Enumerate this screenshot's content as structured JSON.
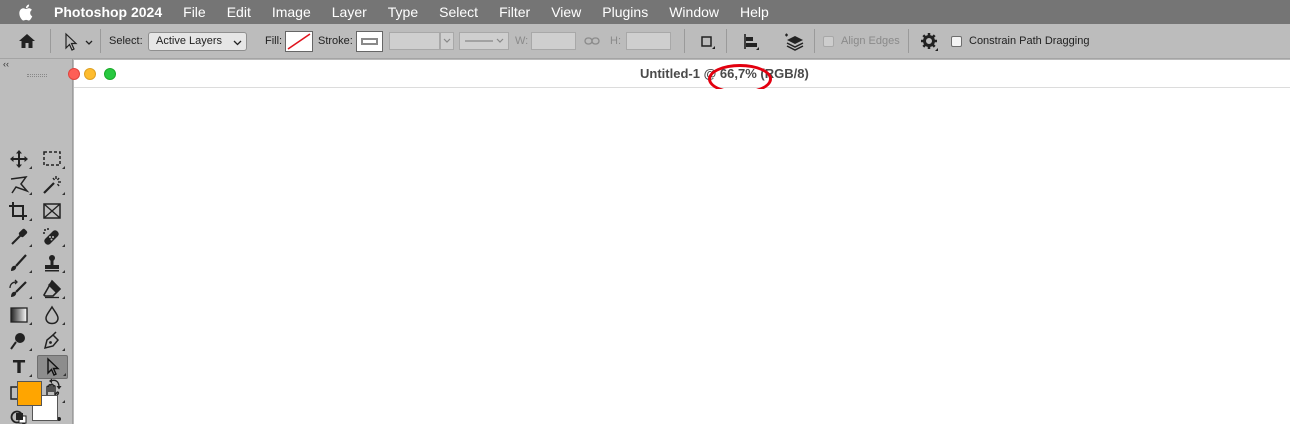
{
  "menubar": {
    "app_name": "Photoshop 2024",
    "items": [
      "File",
      "Edit",
      "Image",
      "Layer",
      "Type",
      "Select",
      "Filter",
      "View",
      "Plugins",
      "Window",
      "Help"
    ]
  },
  "options_bar": {
    "select_label": "Select:",
    "select_value": "Active Layers",
    "fill_label": "Fill:",
    "stroke_label": "Stroke:",
    "w_label": "W:",
    "h_label": "H:",
    "align_edges_label": "Align Edges",
    "constrain_label": "Constrain Path Dragging"
  },
  "toolbox": {
    "collapse_label": "‹‹",
    "type_tool_glyph": "T",
    "foreground_color": "#ffa500",
    "background_color": "#ffffff"
  },
  "document": {
    "title_name": "Untitled-1",
    "title_at": "@",
    "zoom": "66,7%",
    "color_mode": "(RGB/8)"
  },
  "annotation": {
    "color": "#e3000f"
  }
}
